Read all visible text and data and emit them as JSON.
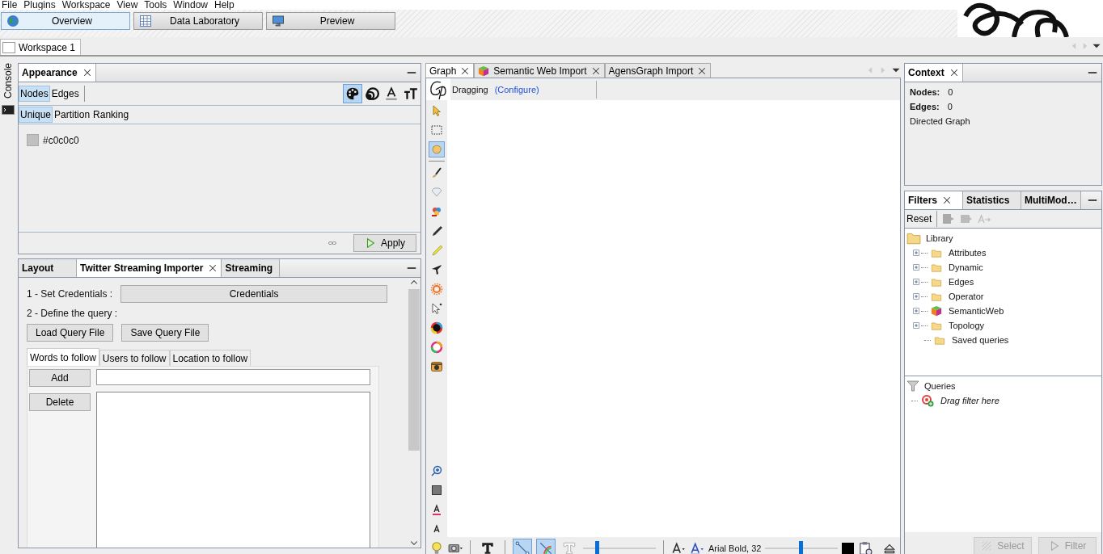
{
  "menu": [
    "File",
    "Plugins",
    "Workspace",
    "View",
    "Tools",
    "Window",
    "Help"
  ],
  "perspectives": [
    {
      "label": "Overview",
      "kind": "globe",
      "selected": true
    },
    {
      "label": "Data Laboratory",
      "kind": "grid",
      "selected": false
    },
    {
      "label": "Preview",
      "kind": "monitor",
      "selected": false
    }
  ],
  "workspace_tabs": [
    {
      "label": "Workspace 1",
      "selected": true
    }
  ],
  "side_strip": {
    "label": "Console"
  },
  "appearance": {
    "tabs": [
      {
        "label": "Appearance",
        "selected": true,
        "closable": true
      }
    ],
    "targets": [
      {
        "label": "Nodes",
        "selected": true
      },
      {
        "label": "Edges",
        "selected": false
      }
    ],
    "properties": [
      {
        "kind": "palette",
        "selected": true
      },
      {
        "kind": "rings",
        "selected": false
      },
      {
        "kind": "label-color",
        "selected": false
      },
      {
        "kind": "label-size",
        "selected": false
      }
    ],
    "modes": [
      {
        "label": "Unique",
        "selected": true
      },
      {
        "label": "Partition",
        "selected": false
      },
      {
        "label": "Ranking",
        "selected": false
      }
    ],
    "swatch": {
      "label": "#c0c0c0",
      "color": "#c0c0c0"
    },
    "apply_button": "Apply"
  },
  "bottom_panel": {
    "tabs": [
      {
        "label": "Layout",
        "selected": false,
        "closable": false
      },
      {
        "label": "Twitter Streaming Importer",
        "selected": true,
        "closable": true
      },
      {
        "label": "Streaming",
        "selected": false,
        "closable": false
      }
    ],
    "step_1": "1 - Set Credentials :",
    "credentials_button": "Credentials",
    "step_2": "2 - Define the query :",
    "file_buttons": [
      "Load Query File",
      "Save Query File"
    ],
    "query_tabs": [
      {
        "label": "Words to follow",
        "selected": true
      },
      {
        "label": "Users to follow",
        "selected": false
      },
      {
        "label": "Location to follow",
        "selected": false
      }
    ],
    "add_button": "Add",
    "delete_button": "Delete"
  },
  "graph": {
    "tabs": [
      {
        "label": "Graph",
        "kind": "none",
        "selected": true
      },
      {
        "label": "Semantic Web Import",
        "kind": "cube",
        "selected": false
      },
      {
        "label": "AgensGraph Import",
        "kind": "none",
        "selected": false
      }
    ],
    "mode": "Dragging",
    "configure_link": "(Configure)",
    "tools": [
      {
        "kind": "pointer",
        "selected": false
      },
      {
        "kind": "dashed-rect",
        "selected": false
      },
      {
        "kind": "hand",
        "selected": true
      },
      {
        "kind": "sep"
      },
      {
        "kind": "brush",
        "selected": false
      },
      {
        "kind": "diamond",
        "selected": false
      },
      {
        "kind": "paint",
        "selected": false
      },
      {
        "kind": "pencil",
        "selected": false
      },
      {
        "kind": "highlighter",
        "selected": false
      },
      {
        "kind": "airplane",
        "selected": false
      },
      {
        "kind": "sun",
        "selected": false
      },
      {
        "kind": "pointer-outline",
        "selected": false
      },
      {
        "kind": "ring",
        "selected": false
      },
      {
        "kind": "ring2",
        "selected": false
      },
      {
        "kind": "camera",
        "selected": false
      },
      {
        "kind": "spacer"
      },
      {
        "kind": "zoom",
        "selected": false
      },
      {
        "kind": "square",
        "selected": false
      },
      {
        "kind": "font-color",
        "selected": false
      },
      {
        "kind": "font-small",
        "selected": false
      }
    ],
    "bottom_toolbar": [
      {
        "kind": "bulb"
      },
      {
        "kind": "camera-caret"
      },
      {
        "kind": "sep"
      },
      {
        "kind": "bold-t",
        "selected": false
      },
      {
        "kind": "sep"
      },
      {
        "kind": "edge-line",
        "selected": true
      },
      {
        "kind": "edge-color",
        "selected": true
      },
      {
        "kind": "outline-t",
        "selected": false
      },
      {
        "kind": "slider",
        "level": 0.18
      },
      {
        "kind": "sep"
      },
      {
        "kind": "font-a"
      },
      {
        "kind": "font-a-blue"
      },
      {
        "kind": "font",
        "label": "Arial Bold, 32"
      },
      {
        "kind": "slider",
        "level": 0.49
      },
      {
        "kind": "swatch",
        "color": "#000000"
      },
      {
        "kind": "clipboard"
      },
      {
        "kind": "spacer"
      },
      {
        "kind": "eject"
      }
    ]
  },
  "context": {
    "tabs": [
      {
        "label": "Context",
        "selected": true,
        "closable": true
      }
    ],
    "nodes_label": "Nodes:",
    "nodes": "0",
    "edges_label": "Edges:",
    "edges": "0",
    "graph_type": "Directed Graph"
  },
  "filters": {
    "tabs": [
      {
        "label": "Filters",
        "selected": true,
        "closable": true
      },
      {
        "label": "Statistics",
        "selected": false,
        "closable": false
      },
      {
        "label": "MultiMod…",
        "selected": false,
        "closable": false
      }
    ],
    "reset_button": "Reset",
    "library": {
      "label": "Library",
      "children": [
        {
          "label": "Attributes",
          "kind": "folder",
          "expander": true
        },
        {
          "label": "Dynamic",
          "kind": "folder",
          "expander": true
        },
        {
          "label": "Edges",
          "kind": "folder",
          "expander": true
        },
        {
          "label": "Operator",
          "kind": "folder",
          "expander": true
        },
        {
          "label": "SemanticWeb",
          "kind": "cube",
          "expander": true
        },
        {
          "label": "Topology",
          "kind": "folder",
          "expander": true
        },
        {
          "label": "Saved queries",
          "kind": "folder",
          "expander": false
        }
      ]
    },
    "queries": {
      "label": "Queries",
      "children": [
        {
          "label": "Drag filter here"
        }
      ]
    },
    "select_button": {
      "label": "Select",
      "disabled": true
    },
    "filter_button": {
      "label": "Filter",
      "disabled": true
    }
  }
}
